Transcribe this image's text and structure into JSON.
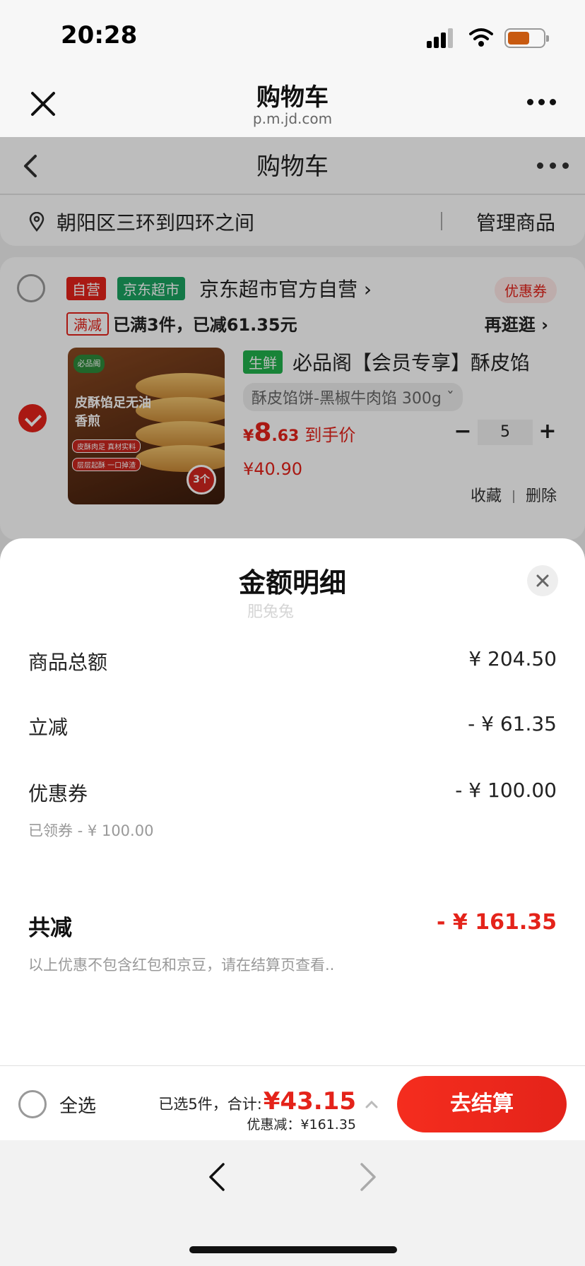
{
  "status_bar": {
    "time": "20:28"
  },
  "webview": {
    "title": "购物车",
    "url": "p.m.jd.com"
  },
  "page": {
    "title": "购物车",
    "address": "朝阳区三环到四环之间",
    "manage": "管理商品",
    "shop": {
      "self_tag": "自营",
      "market_tag": "京东超市",
      "name": "京东超市官方自营 ›",
      "coupon": "优惠券",
      "promo_tag": "满减",
      "promo_text": "已满3件，已减61.35元",
      "promo_more": "再逛逛 ›"
    },
    "product": {
      "fresh_tag": "生鲜",
      "name": "必品阁【会员专享】酥皮馅",
      "spec": "酥皮馅饼-黑椒牛肉馅 300g ˇ",
      "price_symbol": "¥",
      "price_int": "8",
      "price_dec": ".63",
      "price_note": "到手价",
      "orig_price": "¥40.90",
      "quantity": "5",
      "minus": "−",
      "plus": "+",
      "favorite": "收藏",
      "delete": "删除",
      "image": {
        "brand": "必品阁",
        "headline": "皮酥馅足无油香煎",
        "chip1": "皮酥肉足 真材实料",
        "chip2": "层层起酥 一口掉渣",
        "badge": "3个"
      }
    }
  },
  "sheet": {
    "title": "金额明细",
    "watermark": "肥兔兔",
    "rows": [
      {
        "label": "商品总额",
        "value": "¥ 204.50"
      },
      {
        "label": "立减",
        "value": "- ¥ 61.35"
      },
      {
        "label": "优惠券",
        "value": "- ¥ 100.00",
        "sub": "已领券 - ¥ 100.00"
      }
    ],
    "total": {
      "label": "共减",
      "value": "- ¥ 161.35",
      "note": "以上优惠不包含红包和京豆，请在结算页查看.."
    }
  },
  "checkout": {
    "select_all": "全选",
    "selected_prefix": "已选5件，合计:",
    "amount": "¥43.15",
    "discount": "优惠减：¥161.35",
    "button": "去结算"
  },
  "colors": {
    "accent": "#e4231a",
    "green": "#1aa260"
  }
}
